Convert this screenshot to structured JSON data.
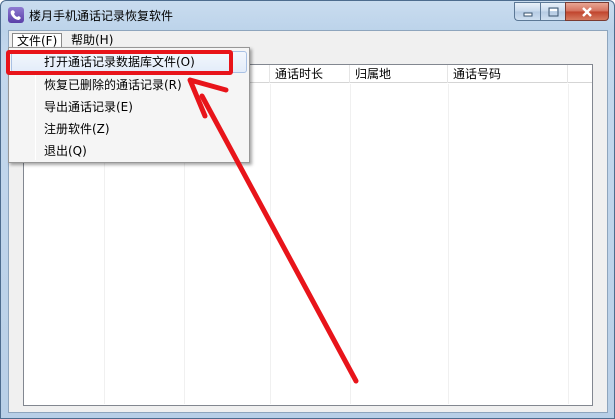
{
  "window": {
    "title": "楼月手机通话记录恢复软件"
  },
  "menubar": {
    "file": "文件(F)",
    "help": "帮助(H)"
  },
  "file_menu": {
    "items": [
      {
        "label": "打开通话记录数据库文件(O)"
      },
      {
        "label": "恢复已删除的通话记录(R)"
      },
      {
        "label": "导出通话记录(E)"
      },
      {
        "label": "注册软件(Z)"
      },
      {
        "label": "退出(Q)"
      }
    ]
  },
  "table": {
    "columns": [
      "通话时长",
      "归属地",
      "通话号码"
    ]
  },
  "colors": {
    "highlight": "#e8141a",
    "titlebar": "#c9dcef"
  }
}
